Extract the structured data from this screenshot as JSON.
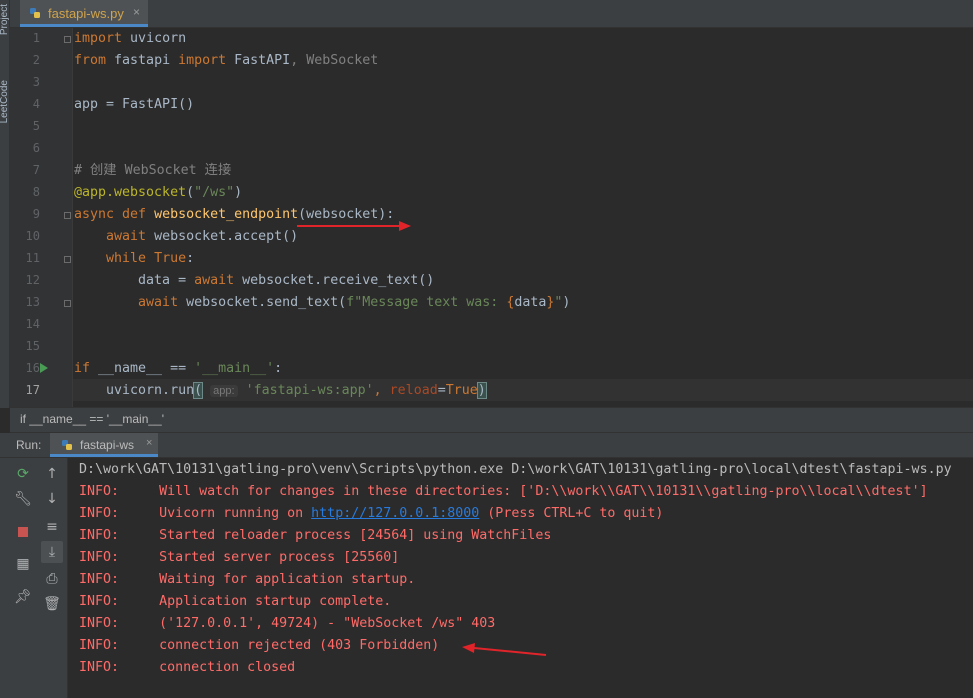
{
  "side_tools": {
    "project_label": "Project",
    "leetcode_label": "LeetCode"
  },
  "tab": {
    "title": "fastapi-ws.py",
    "close_glyph": "×"
  },
  "editor": {
    "line_numbers": [
      "1",
      "2",
      "3",
      "4",
      "5",
      "6",
      "7",
      "8",
      "9",
      "10",
      "11",
      "12",
      "13",
      "14",
      "15",
      "16",
      "17"
    ],
    "current_line": "17"
  },
  "code": {
    "l1_kw": "import",
    "l1_rest": " uvicorn",
    "l2_kw": "from",
    "l2_mod": " fastapi ",
    "l2_kw2": "import",
    "l2_name": " FastAPI",
    "l2_comma": ", ",
    "l2_unused": "WebSocket",
    "l4": "app = FastAPI()",
    "l7": "# 创建 WebSocket 连接",
    "l8_dec": "@app.websocket",
    "l8_open": "(",
    "l8_str": "\"/ws\"",
    "l8_close": ")",
    "l9_kw": "async def ",
    "l9_fn": "websocket_endpoint",
    "l9_rest": "(websocket):",
    "l10_kw": "    await",
    "l10_rest": " websocket.accept()",
    "l11_kw": "    while",
    "l11_sp": " ",
    "l11_true": "True",
    "l11_colon": ":",
    "l12_a": "        data = ",
    "l12_kw": "await",
    "l12_rest": " websocket.receive_text()",
    "l13_kw": "        await",
    "l13_a": " websocket.send_text(",
    "l13_str1": "f\"Message text was: ",
    "l13_b": "{",
    "l13_var": "data",
    "l13_c": "}",
    "l13_str2": "\"",
    "l13_close": ")",
    "l16_kw": "if",
    "l16_a": " __name__ == ",
    "l16_str": "'__main__'",
    "l16_colon": ":",
    "l17_a": "    uvicorn.run",
    "l17_open": "(",
    "l17_hint": "app:",
    "l17_str": "'fastapi-ws:app'",
    "l17_comma": ", ",
    "l17_param": "reload",
    "l17_eq": "=",
    "l17_true": "True",
    "l17_close": ")"
  },
  "breadcrumb": "if __name__ == '__main__'",
  "run": {
    "label": "Run:",
    "tab_title": "fastapi-ws",
    "close_glyph": "×"
  },
  "console": {
    "command": "D:\\work\\GAT\\10131\\gatling-pro\\venv\\Scripts\\python.exe D:\\work\\GAT\\10131\\gatling-pro\\local\\dtest\\fastapi-ws.py",
    "level": "INFO:",
    "lines": [
      "Will watch for changes in these directories: ['D:\\\\work\\\\GAT\\\\10131\\\\gatling-pro\\\\local\\\\dtest']",
      "Uvicorn running on ",
      "Started reloader process [24564] using WatchFiles",
      "Started server process [25560]",
      "Waiting for application startup.",
      "Application startup complete.",
      "('127.0.0.1', 49724) - \"WebSocket /ws\" 403",
      "connection rejected (403 Forbidden)",
      "connection closed"
    ],
    "url": "http://127.0.0.1:8000",
    "url_suffix": " (Press CTRL+C to quit)"
  },
  "colors": {
    "annotation_arrow": "#e0242a",
    "accent": "#4a88c7"
  }
}
